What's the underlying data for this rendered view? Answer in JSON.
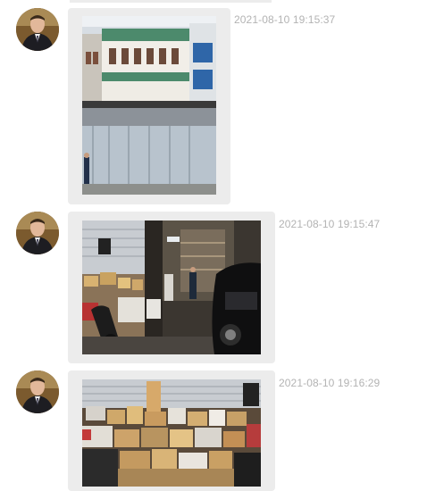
{
  "messages": [
    {
      "timestamp": "2021-08-10 19:15:37",
      "avatar_icon": "user-avatar-man-in-suit",
      "photo_subject": "building-facade-icon"
    },
    {
      "timestamp": "2021-08-10 19:15:47",
      "avatar_icon": "user-avatar-man-in-suit",
      "photo_subject": "warehouse-entrance-icon"
    },
    {
      "timestamp": "2021-08-10 19:16:29",
      "avatar_icon": "user-avatar-man-in-suit",
      "photo_subject": "stacked-parcels-icon"
    }
  ],
  "colors": {
    "bubble": "#ececec",
    "timestamp": "#b3b3b3"
  }
}
